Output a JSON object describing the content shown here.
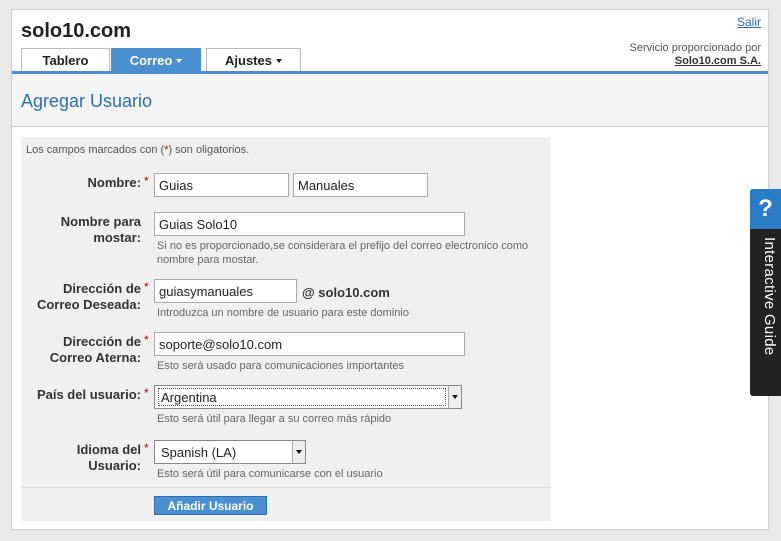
{
  "header": {
    "brand": "solo10.com",
    "logout_link": "Salir",
    "provider_text": "Servicio proporcionado por",
    "provider_name": "Solo10.com S.A."
  },
  "tabs": [
    {
      "label": "Tablero",
      "active": false,
      "dropdown": false
    },
    {
      "label": "Correo",
      "active": true,
      "dropdown": true
    },
    {
      "label": "Ajustes",
      "active": false,
      "dropdown": true
    }
  ],
  "page": {
    "title": "Agregar Usuario"
  },
  "form": {
    "required_note_pre": "Los campos marcados con (",
    "required_note_star": "*",
    "required_note_post": ") son oligatorios.",
    "first_name": {
      "label": "Nombre:",
      "value": "Guias"
    },
    "last_name": {
      "value": "Manuales"
    },
    "display_name": {
      "label": "Nombre para mostar:",
      "value": "Guias Solo10",
      "help": "Si no es proporcionado,se considerara el prefijo del correo electronico como nombre para mostar."
    },
    "desired_email": {
      "label": "Dirección de Correo Deseada:",
      "value": "guiasymanuales",
      "domain": "@ solo10.com",
      "help": "Introduzca un nombre de usuario para este dominio"
    },
    "alternate_email": {
      "label": "Dirección de Correo Aterna:",
      "value": "soporte@solo10.com",
      "help": "Esto será usado para comunicaciones importantes"
    },
    "country": {
      "label": "País del usuario:",
      "value": "Argentina",
      "help": "Esto será útil para llegar a su correo más rápido"
    },
    "language": {
      "label": "Idioma del Usuario:",
      "value": "Spanish (LA)",
      "help": "Esto será útil para comunicarse con el usuario"
    },
    "submit_label": "Añadir Usuario"
  },
  "guide": {
    "label": "Interactive Guide",
    "icon": "question-icon",
    "icon_glyph": "?"
  },
  "colors": {
    "accent": "#4a8fd0",
    "link": "#2a6fb5",
    "required": "#cc0000"
  }
}
